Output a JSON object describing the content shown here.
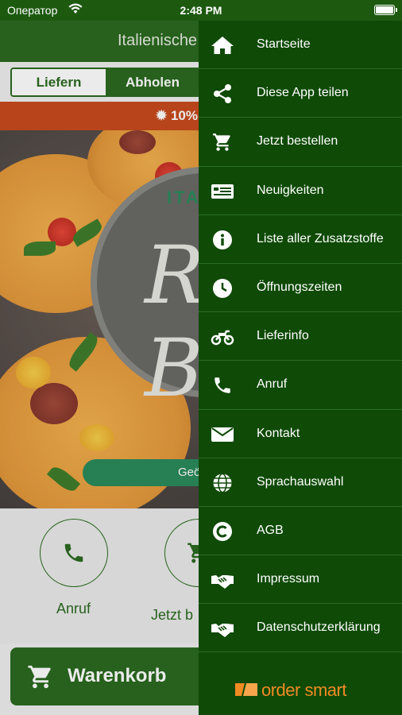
{
  "status_bar": {
    "carrier": "Оператор",
    "time": "2:48 PM"
  },
  "header": {
    "title": "Italienische"
  },
  "order_mode": {
    "delivery_label": "Liefern",
    "pickup_label": "Abholen"
  },
  "promo": {
    "text": "10%"
  },
  "hero": {
    "logo_text": "Ri Bo",
    "badge_top_text": "ITA",
    "status_button_partial": "Geö"
  },
  "actions": {
    "call_label": "Anruf",
    "order_label": "Jetzt b"
  },
  "cart": {
    "label": "Warenkorb"
  },
  "drawer": {
    "items": [
      {
        "label": "Startseite",
        "icon": "home-icon"
      },
      {
        "label": "Diese App teilen",
        "icon": "share-icon"
      },
      {
        "label": "Jetzt bestellen",
        "icon": "cart-icon"
      },
      {
        "label": "Neuigkeiten",
        "icon": "news-icon"
      },
      {
        "label": "Liste aller Zusatzstoffe",
        "icon": "info-icon"
      },
      {
        "label": "Öffnungszeiten",
        "icon": "clock-icon"
      },
      {
        "label": "Lieferinfo",
        "icon": "motorcycle-icon"
      },
      {
        "label": "Anruf",
        "icon": "phone-icon"
      },
      {
        "label": "Kontakt",
        "icon": "envelope-icon"
      },
      {
        "label": "Sprachauswahl",
        "icon": "globe-icon"
      },
      {
        "label": "AGB",
        "icon": "copyright-icon"
      },
      {
        "label": "Impressum",
        "icon": "handshake-icon"
      },
      {
        "label": "Datenschutzerklärung",
        "icon": "handshake-icon"
      }
    ],
    "brand": "order smart"
  },
  "colors": {
    "drawer_bg": "#0f4a07",
    "brand_green": "#2b6a20",
    "promo_bg": "#c84a1e",
    "brand_orange": "#f08a22"
  }
}
